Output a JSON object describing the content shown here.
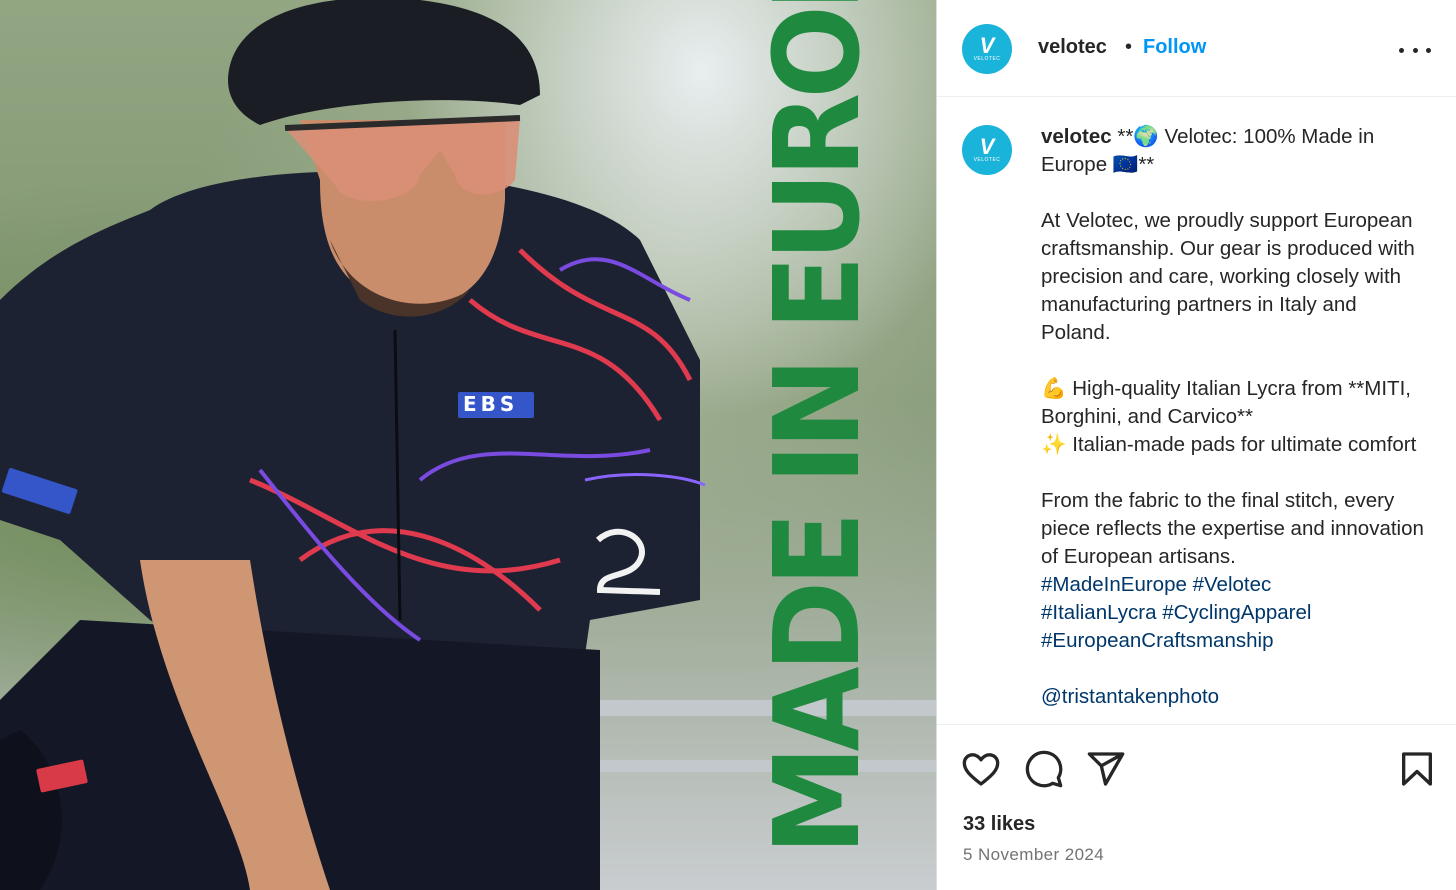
{
  "post": {
    "image": {
      "overlay_text": "MADE IN EUROPE",
      "overlay_color": "#1f8a3f",
      "jersey_logo_text": "EBS"
    },
    "header": {
      "username": "velotec",
      "separator": "•",
      "follow_label": "Follow",
      "avatar_mark": "V",
      "avatar_word": "VELOTEC",
      "more_icon": "more-horizontal-icon"
    },
    "caption": {
      "username": "velotec",
      "title": "**🌍 Velotec: 100% Made in Europe 🇪🇺**",
      "paragraph1": "At Velotec, we proudly support European craftsmanship. Our gear is produced with precision and care, working closely with manufacturing partners in Italy and Poland.",
      "bullet1": "💪 High-quality Italian Lycra from **MITI, Borghini, and Carvico**",
      "bullet2": "✨ Italian-made pads for ultimate comfort",
      "paragraph3": "From the fabric to the final stitch, every piece reflects the expertise and innovation of European artisans.",
      "hashtags": [
        "#MadeInEurope",
        "#Velotec",
        "#ItalianLycra",
        "#CyclingApparel",
        "#EuropeanCraftsmanship"
      ],
      "mention": "@tristantakenphoto"
    },
    "actions": {
      "like_icon": "heart-icon",
      "comment_icon": "comment-icon",
      "share_icon": "send-icon",
      "save_icon": "bookmark-icon"
    },
    "likes": "33 likes",
    "date": "5 November 2024",
    "colors": {
      "link_blue": "#0095f6",
      "hashtag_blue": "#00376b",
      "avatar_bg": "#1ab3d9",
      "muted_text": "#737373"
    }
  }
}
